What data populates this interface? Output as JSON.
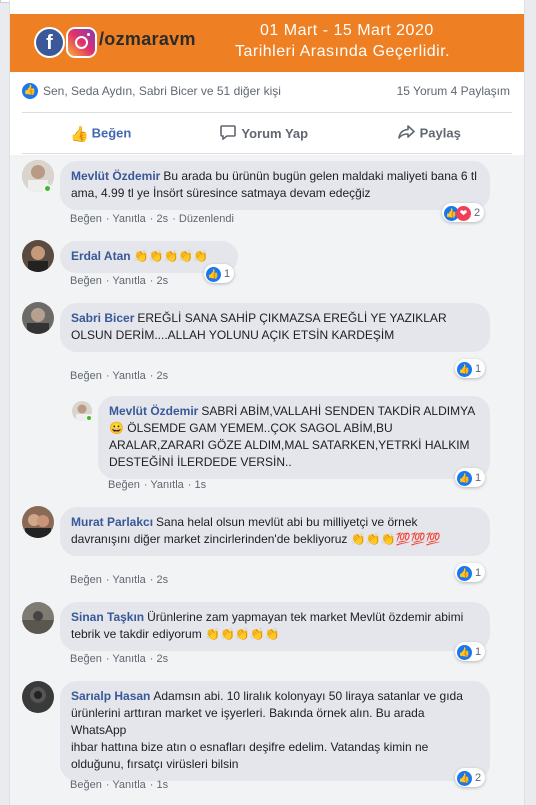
{
  "banner": {
    "fb_glyph": "f",
    "handle": "/ozmaravm",
    "line1": "01 Mart - 15 Mart 2020",
    "line2": "Tarihleri Arasında Geçerlidir.",
    "color": "#ee7f22"
  },
  "stats": {
    "names": "Sen, Seda Aydın, Sabri Bicer ve 51 diğer kişi",
    "counts": "15 Yorum  4 Paylaşım"
  },
  "actions": {
    "like": "Beğen",
    "comment": "Yorum Yap",
    "share": "Paylaş"
  },
  "comments": [
    {
      "author": "Mevlüt Özdemir",
      "text": "Bu arada bu ürünün bugün gelen maldaki maliyeti bana 6 tl ama, 4.99 tl ye İnsört süresince satmaya devam edeçğiz",
      "meta": {
        "like": "Beğen",
        "reply": "Yanıtla",
        "time": "2s",
        "edited": "Düzenlendi"
      },
      "reactions": "2"
    },
    {
      "author": "Erdal Atan",
      "text": "👏👏👏👏👏",
      "meta": {
        "like": "Beğen",
        "reply": "Yanıtla",
        "time": "2s"
      },
      "reactions": "1"
    },
    {
      "author": "Sabri Bicer",
      "text": "EREĞLİ SANA SAHİP ÇIKMAZSA EREĞLİ YE YAZIKLAR OLSUN DERİM....ALLAH YOLUNU AÇIK ETSİN KARDEŞİM",
      "meta": {
        "like": "Beğen",
        "reply": "Yanıtla",
        "time": "2s"
      },
      "reactions": "1"
    },
    {
      "author": "Mevlüt Özdemir",
      "text": "SABRİ ABİM,VALLAHİ SENDEN TAKDİR ALDIMYA 😀 ÖLSEMDE GAM YEMEM..ÇOK SAGOL ABİM,BU ARALAR,ZARARI GÖZE ALDIM,MAL SATARKEN,YETRKİ HALKIM DESTEĞİNİ İLERDEDE VERSİN..",
      "meta": {
        "like": "Beğen",
        "reply": "Yanıtla",
        "time": "1s"
      },
      "reactions": "1"
    },
    {
      "author": "Murat Parlakcı",
      "text": "Sana helal olsun mevlüt abi bu milliyetçi ve örnek davranışını diğer market zincirlerinden'de bekliyoruz 👏👏👏💯💯💯",
      "meta": {
        "like": "Beğen",
        "reply": "Yanıtla",
        "time": "2s"
      },
      "reactions": "1"
    },
    {
      "author": "Sinan Taşkın",
      "text": "Ürünlerine zam yapmayan tek market Mevlüt özdemir abimi tebrik ve takdir ediyorum 👏👏👏👏👏",
      "meta": {
        "like": "Beğen",
        "reply": "Yanıtla",
        "time": "2s"
      },
      "reactions": "1"
    },
    {
      "author": "Sarıalp Hasan",
      "text": "Adamsın abi. 10 liralık kolonyayı 50 liraya satanlar ve gıda ürünlerini arttıran market ve işyerleri. Bakında örnek alın. Bu arada WhatsApp",
      "text2": "ihbar hattına bize atın o esnafları deşifre edelim. Vatandaş kimin ne olduğunu, fırsatçı virüsleri bilsin",
      "meta": {
        "like": "Beğen",
        "reply": "Yanıtla",
        "time": "1s"
      },
      "reactions": "2"
    }
  ]
}
